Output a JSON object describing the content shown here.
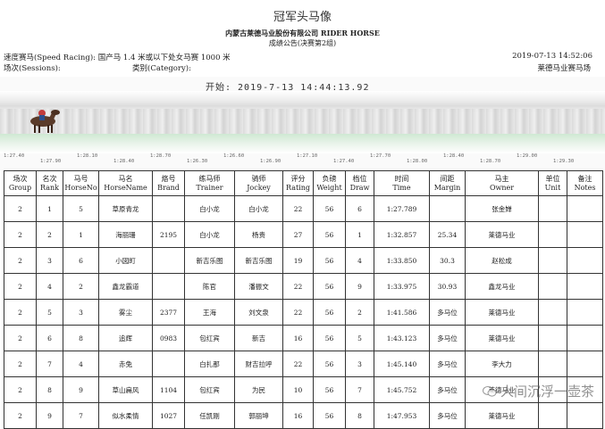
{
  "caption": "冠军头马像",
  "header": {
    "company": "内蒙古莱德马业股份有限公司 RIDER HORSE",
    "announcement": "成绩公告(决赛第2组)",
    "race_label": "速度赛马(Speed Racing): 国产马 1.4 米或以下处女马赛 1000 米",
    "datetime": "2019-07-13 14:52:06",
    "session_label": "场次(Sessions):",
    "category_label": "类别(Category):",
    "venue": "莱德马业赛马场"
  },
  "photo": {
    "start_text": "开始: 2019-7-13 14:44:13.92",
    "ticks": [
      "1:27.40",
      "1:27.90",
      "1:28.10",
      "1:28.40",
      "1:28.70",
      "1:26.30",
      "1:26.60",
      "1:26.90",
      "1:27.10",
      "1:27.40",
      "1:27.70",
      "1:28.00",
      "1:28.40",
      "1:28.70",
      "1:29.00",
      "1:29.30"
    ]
  },
  "table": {
    "headers": [
      {
        "cn": "场次",
        "en": "Group"
      },
      {
        "cn": "名次",
        "en": "Rank"
      },
      {
        "cn": "马号",
        "en": "HorseNo"
      },
      {
        "cn": "马名",
        "en": "HorseName"
      },
      {
        "cn": "烙号",
        "en": "Brand"
      },
      {
        "cn": "练马师",
        "en": "Trainer"
      },
      {
        "cn": "骑师",
        "en": "Jockey"
      },
      {
        "cn": "评分",
        "en": "Rating"
      },
      {
        "cn": "负磅",
        "en": "Weight"
      },
      {
        "cn": "档位",
        "en": "Draw"
      },
      {
        "cn": "时间",
        "en": "Time"
      },
      {
        "cn": "间距",
        "en": "Margin"
      },
      {
        "cn": "马主",
        "en": "Owner"
      },
      {
        "cn": "单位",
        "en": "Unit"
      },
      {
        "cn": "备注",
        "en": "Notes"
      }
    ],
    "rows": [
      [
        "2",
        "1",
        "5",
        "草原青龙",
        "",
        "白小龙",
        "白小龙",
        "22",
        "56",
        "6",
        "1:27.789",
        "",
        "张金婵",
        "",
        ""
      ],
      [
        "2",
        "2",
        "1",
        "海丽珊",
        "2195",
        "白小龙",
        "杨贵",
        "27",
        "56",
        "1",
        "1:32.857",
        "25.34",
        "莱德马业",
        "",
        ""
      ],
      [
        "2",
        "3",
        "6",
        "小図町",
        "",
        "新吉乐图",
        "新吉乐图",
        "19",
        "56",
        "4",
        "1:33.850",
        "30.3",
        "赵松成",
        "",
        ""
      ],
      [
        "2",
        "4",
        "2",
        "鑫龙霸道",
        "",
        "陈官",
        "潘振文",
        "22",
        "56",
        "9",
        "1:33.975",
        "30.93",
        "鑫龙马业",
        "",
        ""
      ],
      [
        "2",
        "5",
        "3",
        "雾尘",
        "2377",
        "王海",
        "刘文泉",
        "22",
        "56",
        "2",
        "1:41.586",
        "多马位",
        "莱德马业",
        "",
        ""
      ],
      [
        "2",
        "6",
        "8",
        "追辉",
        "0983",
        "包红宾",
        "新吉",
        "16",
        "56",
        "5",
        "1:43.123",
        "多马位",
        "莱德马业",
        "",
        ""
      ],
      [
        "2",
        "7",
        "4",
        "赤兔",
        "",
        "白扎那",
        "财吉拉呼",
        "22",
        "56",
        "3",
        "1:45.140",
        "多马位",
        "李大力",
        "",
        ""
      ],
      [
        "2",
        "8",
        "9",
        "草山扁风",
        "1104",
        "包红宾",
        "为民",
        "10",
        "56",
        "7",
        "1:45.752",
        "多马位",
        "莱德马业",
        "",
        ""
      ],
      [
        "2",
        "9",
        "7",
        "似水柔情",
        "1027",
        "任凯刚",
        "郭丽坤",
        "16",
        "56",
        "8",
        "1:47.953",
        "多马位",
        "莱德马业",
        "",
        ""
      ]
    ]
  },
  "watermark": "人间沉浮一壶茶"
}
